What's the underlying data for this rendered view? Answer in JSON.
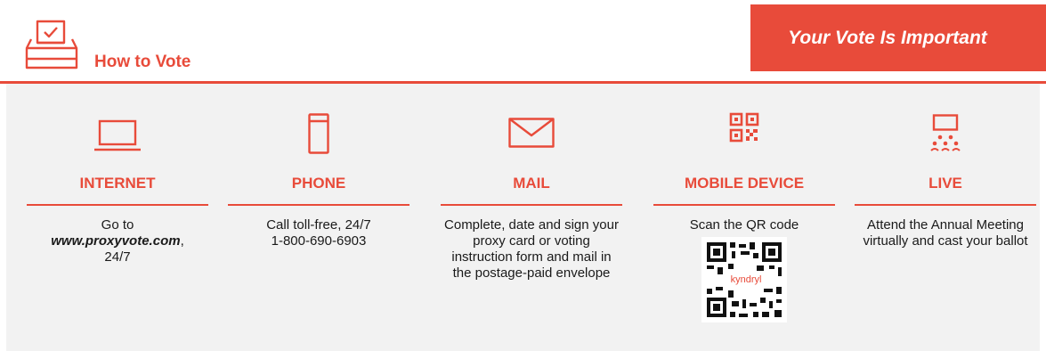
{
  "header": {
    "title": "How to Vote",
    "banner": "Your Vote Is Important"
  },
  "methods": [
    {
      "id": "internet",
      "icon": "laptop-icon",
      "heading": "INTERNET",
      "line1": "Go to",
      "url": "www.proxyvote.com",
      "url_suffix": ",",
      "line3": "24/7"
    },
    {
      "id": "phone",
      "icon": "phone-icon",
      "heading": "PHONE",
      "line1": "Call toll-free, 24/7",
      "line2": "1-800-690-6903"
    },
    {
      "id": "mail",
      "icon": "envelope-icon",
      "heading": "MAIL",
      "text": "Complete, date and sign your proxy card or voting instruction form and mail in the postage-paid envelope"
    },
    {
      "id": "mobile",
      "icon": "qr-code-icon",
      "heading": "MOBILE DEVICE",
      "line1": "Scan the QR code",
      "qr_label": "kyndryl"
    },
    {
      "id": "live",
      "icon": "meeting-icon",
      "heading": "LIVE",
      "text": "Attend the Annual Meeting virtually and cast your ballot"
    }
  ],
  "colors": {
    "accent": "#e84b3a",
    "panel": "#f2f2f2",
    "text": "#1a1a1a"
  }
}
